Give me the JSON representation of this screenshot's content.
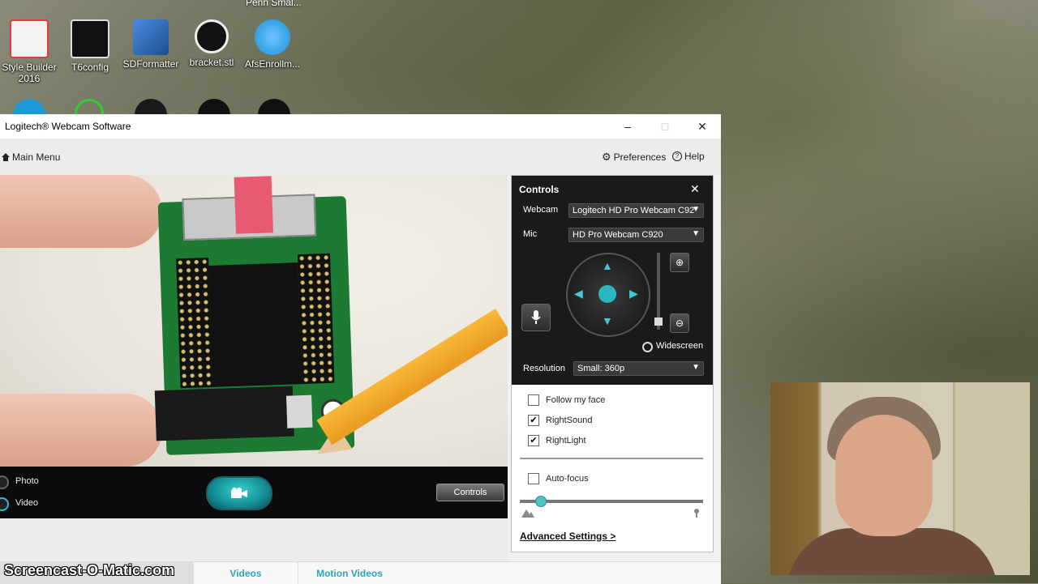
{
  "desktop": {
    "top_partial_label": "Penn Smal...",
    "icons": [
      {
        "label": "Style Builder 2016",
        "icon": "style-builder-icon",
        "color": "#e23b3b"
      },
      {
        "label": "T6config",
        "icon": "t6config-icon",
        "color": "#1a1a1a"
      },
      {
        "label": "SDFormatter",
        "icon": "sdformatter-icon",
        "color": "#2f6fb7"
      },
      {
        "label": "bracket.stl",
        "icon": "stl-file-icon",
        "color": "#111111"
      },
      {
        "label": "AfsEnrollm...",
        "icon": "globe-icon",
        "color": "#1f8fd4"
      }
    ]
  },
  "window": {
    "title": "Logitech® Webcam Software",
    "controls": {
      "minimize": "–",
      "maximize": "□",
      "close": "✕"
    }
  },
  "menubar": {
    "main_menu": "Main Menu",
    "preferences": "Preferences",
    "help": "Help"
  },
  "video_bar": {
    "modes": [
      {
        "label": "Photo",
        "selected": false
      },
      {
        "label": "Video",
        "selected": true
      }
    ],
    "capture_icon": "video-camera-icon",
    "controls_button": "Controls"
  },
  "tabs": [
    {
      "label": "",
      "active": true
    },
    {
      "label": "Videos",
      "active": false
    },
    {
      "label": "Motion Videos",
      "active": false
    }
  ],
  "controls_panel": {
    "title": "Controls",
    "webcam_label": "Webcam",
    "webcam_value": "Logitech HD Pro Webcam C92",
    "mic_label": "Mic",
    "mic_value": "HD Pro Webcam C920",
    "widescreen_label": "Widescreen",
    "resolution_label": "Resolution",
    "resolution_value": "Small: 360p",
    "checkboxes": [
      {
        "label": "Follow my face",
        "checked": false
      },
      {
        "label": "RightSound",
        "checked": true
      },
      {
        "label": "RightLight",
        "checked": true
      }
    ],
    "autofocus": {
      "label": "Auto-focus",
      "checked": false
    },
    "advanced_settings": "Advanced Settings >",
    "accent_color": "#3ec9d3"
  },
  "watermark": "Screencast-O-Matic.com"
}
